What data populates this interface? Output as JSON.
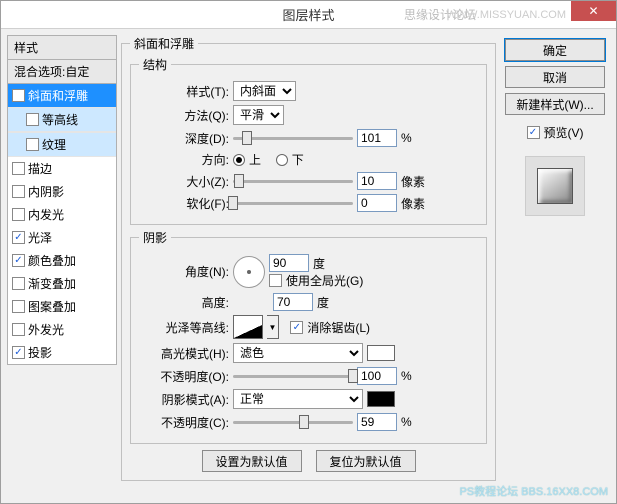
{
  "window": {
    "title": "图层样式",
    "watermark_forum": "思缘设计论坛",
    "watermark_url": "WWW.MISSYUAN.COM",
    "bottom_wm": "PS教程论坛 BBS.16XX8.COM"
  },
  "left": {
    "header": "样式",
    "blend": "混合选项:自定",
    "items": [
      {
        "label": "斜面和浮雕",
        "checked": true,
        "selected": true
      },
      {
        "label": "等高线",
        "checked": false,
        "sub": true,
        "selectedSub": true
      },
      {
        "label": "纹理",
        "checked": false,
        "sub": true,
        "selectedSub": true
      },
      {
        "label": "描边",
        "checked": false
      },
      {
        "label": "内阴影",
        "checked": false
      },
      {
        "label": "内发光",
        "checked": false
      },
      {
        "label": "光泽",
        "checked": true
      },
      {
        "label": "颜色叠加",
        "checked": true
      },
      {
        "label": "渐变叠加",
        "checked": false
      },
      {
        "label": "图案叠加",
        "checked": false
      },
      {
        "label": "外发光",
        "checked": false
      },
      {
        "label": "投影",
        "checked": true
      }
    ]
  },
  "bevel": {
    "group": "斜面和浮雕",
    "structure": "结构",
    "style_l": "样式(T):",
    "style_v": "内斜面",
    "method_l": "方法(Q):",
    "method_v": "平滑",
    "depth_l": "深度(D):",
    "depth_v": "101",
    "pct": "%",
    "dir_l": "方向:",
    "up": "上",
    "down": "下",
    "size_l": "大小(Z):",
    "size_v": "10",
    "px": "像素",
    "soft_l": "软化(F):",
    "soft_v": "0",
    "shadow": "阴影",
    "angle_l": "角度(N):",
    "angle_v": "90",
    "deg": "度",
    "global": "使用全局光(G)",
    "alt_l": "高度:",
    "alt_v": "70",
    "gloss_l": "光泽等高线:",
    "aa": "消除锯齿(L)",
    "hl_l": "高光模式(H):",
    "hl_v": "滤色",
    "hl_op_l": "不透明度(O):",
    "hl_op_v": "100",
    "sh_l": "阴影模式(A):",
    "sh_v": "正常",
    "sh_op_l": "不透明度(C):",
    "sh_op_v": "59",
    "reset_default": "设置为默认值",
    "reset_to": "复位为默认值"
  },
  "right": {
    "ok": "确定",
    "cancel": "取消",
    "newstyle": "新建样式(W)...",
    "preview": "预览(V)"
  }
}
